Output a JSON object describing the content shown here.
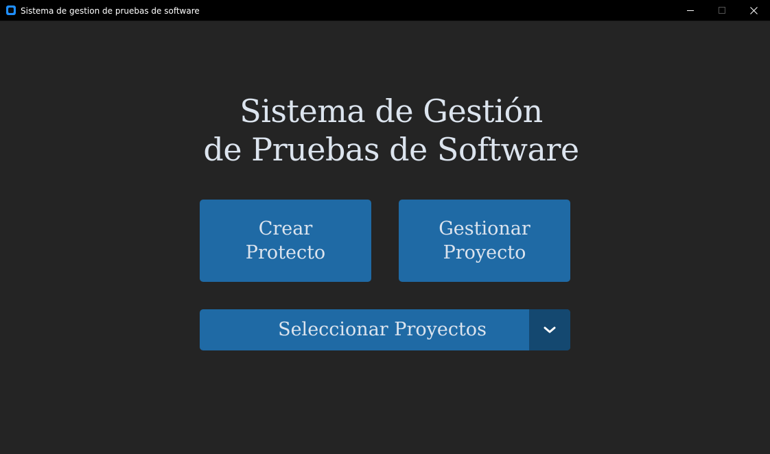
{
  "window": {
    "title": "Sistema de gestion de pruebas de software",
    "controls": [
      "minimize-icon",
      "maximize-icon",
      "close-icon"
    ]
  },
  "main": {
    "heading_line1": "Sistema de Gestión",
    "heading_line2": "de Pruebas de Software",
    "crear_button": {
      "line1": "Crear",
      "line2": "Protecto"
    },
    "gestionar_button": {
      "line1": "Gestionar",
      "line2": "Proyecto"
    },
    "project_select": {
      "value": "Seleccionar Proyectos",
      "icon": "chevron-down-icon"
    }
  },
  "colors": {
    "background": "#242424",
    "titlebar": "#000000",
    "accent": "#1f6aa5",
    "accent_dark": "#144870",
    "text": "#dce4ee"
  }
}
